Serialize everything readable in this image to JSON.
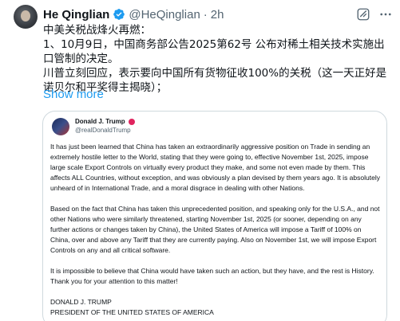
{
  "author": {
    "name": "He Qinglian",
    "handle": "@HeQinglian",
    "separator": "·",
    "time": "2h"
  },
  "tweet": {
    "lines": [
      "中美关税战烽火再燃：",
      "1、10月9日，中国商务部公告2025第62号 公布对稀土相关技术实施出口管制的决定。",
      "川普立刻回应，表示要向中国所有货物征收100%的关税（这一天正好是诺贝尔和平奖得主揭晓）；"
    ],
    "show_more": "Show more"
  },
  "embedded": {
    "name": "Donald J. Trump",
    "handle": "@realDonaldTrump",
    "paragraphs": [
      "It has just been learned that China has taken an extraordinarily aggressive position on Trade in sending an extremely hostile letter to the World, stating that they were going to, effective November 1st, 2025, impose large scale Export Controls on virtually every product they make, and some not even made by them. This affects ALL Countries, without exception, and was obviously a plan devised by them years ago. It is absolutely unheard of in International Trade, and a moral disgrace in dealing with other Nations.",
      "Based on the fact that China has taken this unprecedented position, and speaking only for the U.S.A., and not other Nations who were similarly threatened, starting November 1st, 2025 (or sooner, depending on any further actions or changes taken by China), the United States of America will impose a Tariff of 100% on China, over and above any Tariff that they are currently paying. Also on November 1st, we will impose Export Controls on any and all critical software.",
      "It is impossible to believe that China would have taken such an action, but they have, and the rest is History. Thank you for your attention to this matter!"
    ],
    "signature_name": "DONALD J. TRUMP",
    "signature_title": "PRESIDENT OF THE UNITED STATES OF AMERICA"
  },
  "colors": {
    "link": "#1d9bf0",
    "muted": "#536471",
    "verified": "#1d9bf0"
  },
  "icons": [
    "verified-badge-icon",
    "grok-icon",
    "more-options-icon"
  ]
}
